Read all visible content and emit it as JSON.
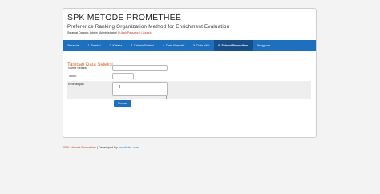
{
  "header": {
    "title": "SPK METODE PROMETHEE",
    "subtitle": "Preference Ranking Organization Method for Enrichment Evaluation"
  },
  "welcome": {
    "text": "Selamat Datang: Admin (Administrator) |",
    "link": "Ubah Password",
    "separator": "|",
    "logout": "Logout"
  },
  "nav": {
    "items": [
      {
        "label": "Beranda"
      },
      {
        "label": "1. Seleksi"
      },
      {
        "label": "2. Kriteria"
      },
      {
        "label": "3. Kriteria Seleksi"
      },
      {
        "label": "4. Data Alternatif"
      },
      {
        "label": "5. Data Nilai"
      },
      {
        "label": "6. Seleksi Promethee"
      },
      {
        "label": "Pengguna"
      }
    ],
    "active_index": 6,
    "color": "#1f6fbf"
  },
  "form": {
    "section_title": "Tambah Data Seleksi",
    "fields": [
      {
        "label": "Nama Seleksi",
        "sep": ":",
        "value": ""
      },
      {
        "label": "Tahun",
        "sep": ":",
        "value": ""
      },
      {
        "label": "Keterangan",
        "sep": ":",
        "value": ""
      }
    ],
    "submit_label": "Simpan",
    "textarea_cursor": "I"
  },
  "footer": {
    "app": "SPK Metode Promethee",
    "separator": " | Developed By ",
    "site": "anasticles.com"
  }
}
